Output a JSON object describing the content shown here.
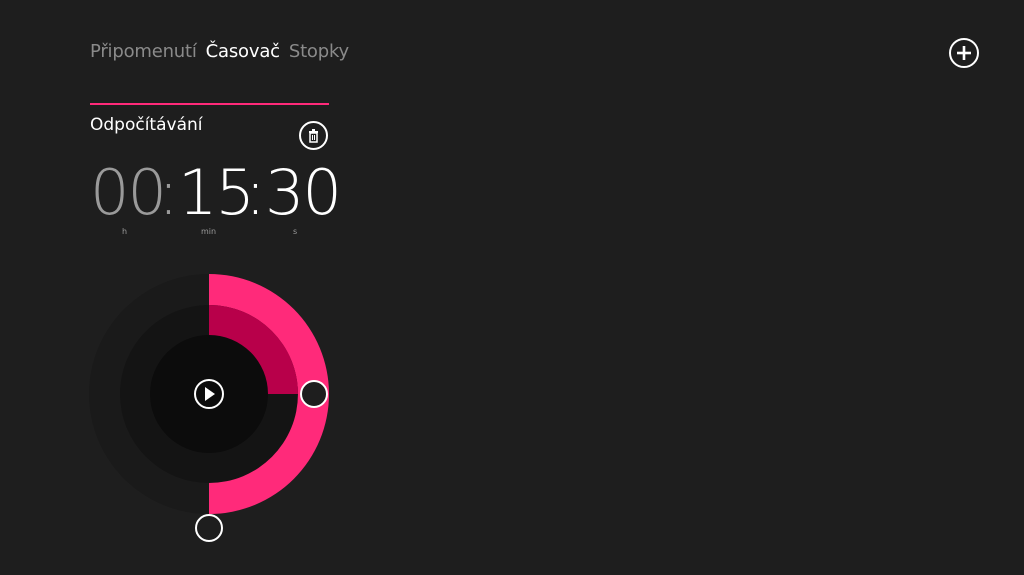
{
  "nav": {
    "tabs": [
      {
        "label": "Připomenutí",
        "active": false
      },
      {
        "label": "Časovač",
        "active": true
      },
      {
        "label": "Stopky",
        "active": false
      }
    ],
    "add_icon": "plus-circle-icon"
  },
  "timer": {
    "name": "Odpočítávání",
    "delete_icon": "trash-icon",
    "time": {
      "hours": "00",
      "minutes": "15",
      "seconds": "30",
      "separator": ":"
    },
    "units": {
      "hours": "h",
      "minutes": "min",
      "seconds": "s"
    },
    "play_icon": "play-icon",
    "dial": {
      "minutes_fraction": 0.25,
      "seconds_fraction": 0.5
    }
  },
  "colors": {
    "background": "#1e1e1e",
    "accent": "#ff2a7a",
    "accent_dark": "#b8004a",
    "text": "#ffffff",
    "muted_text": "#9a9a9a"
  }
}
